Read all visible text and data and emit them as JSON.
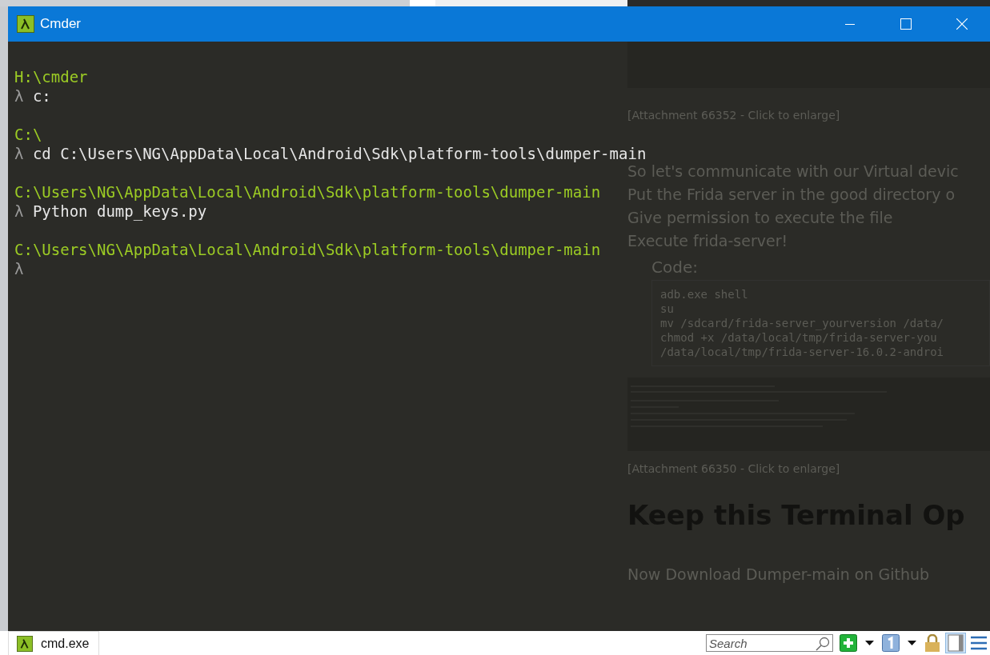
{
  "window": {
    "title": "Cmder"
  },
  "terminal": {
    "lines": [
      {
        "kind": "blank"
      },
      {
        "kind": "path",
        "text": "H:\\cmder"
      },
      {
        "kind": "command",
        "prompt": "λ",
        "text": "c:"
      },
      {
        "kind": "blank"
      },
      {
        "kind": "path",
        "text": "C:\\"
      },
      {
        "kind": "command",
        "prompt": "λ",
        "text": "cd C:\\Users\\NG\\AppData\\Local\\Android\\Sdk\\platform-tools\\dumper-main"
      },
      {
        "kind": "blank"
      },
      {
        "kind": "path",
        "text": "C:\\Users\\NG\\AppData\\Local\\Android\\Sdk\\platform-tools\\dumper-main"
      },
      {
        "kind": "command",
        "prompt": "λ",
        "text": "Python dump_keys.py"
      },
      {
        "kind": "blank"
      },
      {
        "kind": "path",
        "text": "C:\\Users\\NG\\AppData\\Local\\Android\\Sdk\\platform-tools\\dumper-main"
      },
      {
        "kind": "command",
        "prompt": "λ"
      }
    ]
  },
  "background_page": {
    "blocks": [
      {
        "kind": "caption",
        "text": "[Attachment 66352 - Click to enlarge]"
      },
      {
        "kind": "paragraph",
        "lines": [
          "So let's communicate with our Virtual devic",
          "Put the Frida server in the good directory o",
          "Give permission to execute the file",
          "Execute frida-server!"
        ]
      },
      {
        "kind": "code",
        "label": "Code:",
        "lines": [
          "adb.exe shell",
          "su",
          "mv /sdcard/frida-server_yourversion /data/",
          "chmod  +x /data/local/tmp/frida-server-you",
          "/data/local/tmp/frida-server-16.0.2-androi"
        ]
      },
      {
        "kind": "picture"
      },
      {
        "kind": "caption",
        "text": "[Attachment 66350 - Click to enlarge]"
      },
      {
        "kind": "heading",
        "text": "Keep this Terminal Op"
      },
      {
        "kind": "paragraph",
        "lines": [
          "Now Download Dumper-main on Github"
        ]
      }
    ]
  },
  "status_bar": {
    "tabs": [
      {
        "label": "cmd.exe",
        "selected": true
      }
    ],
    "search": {
      "placeholder": "Search"
    }
  }
}
